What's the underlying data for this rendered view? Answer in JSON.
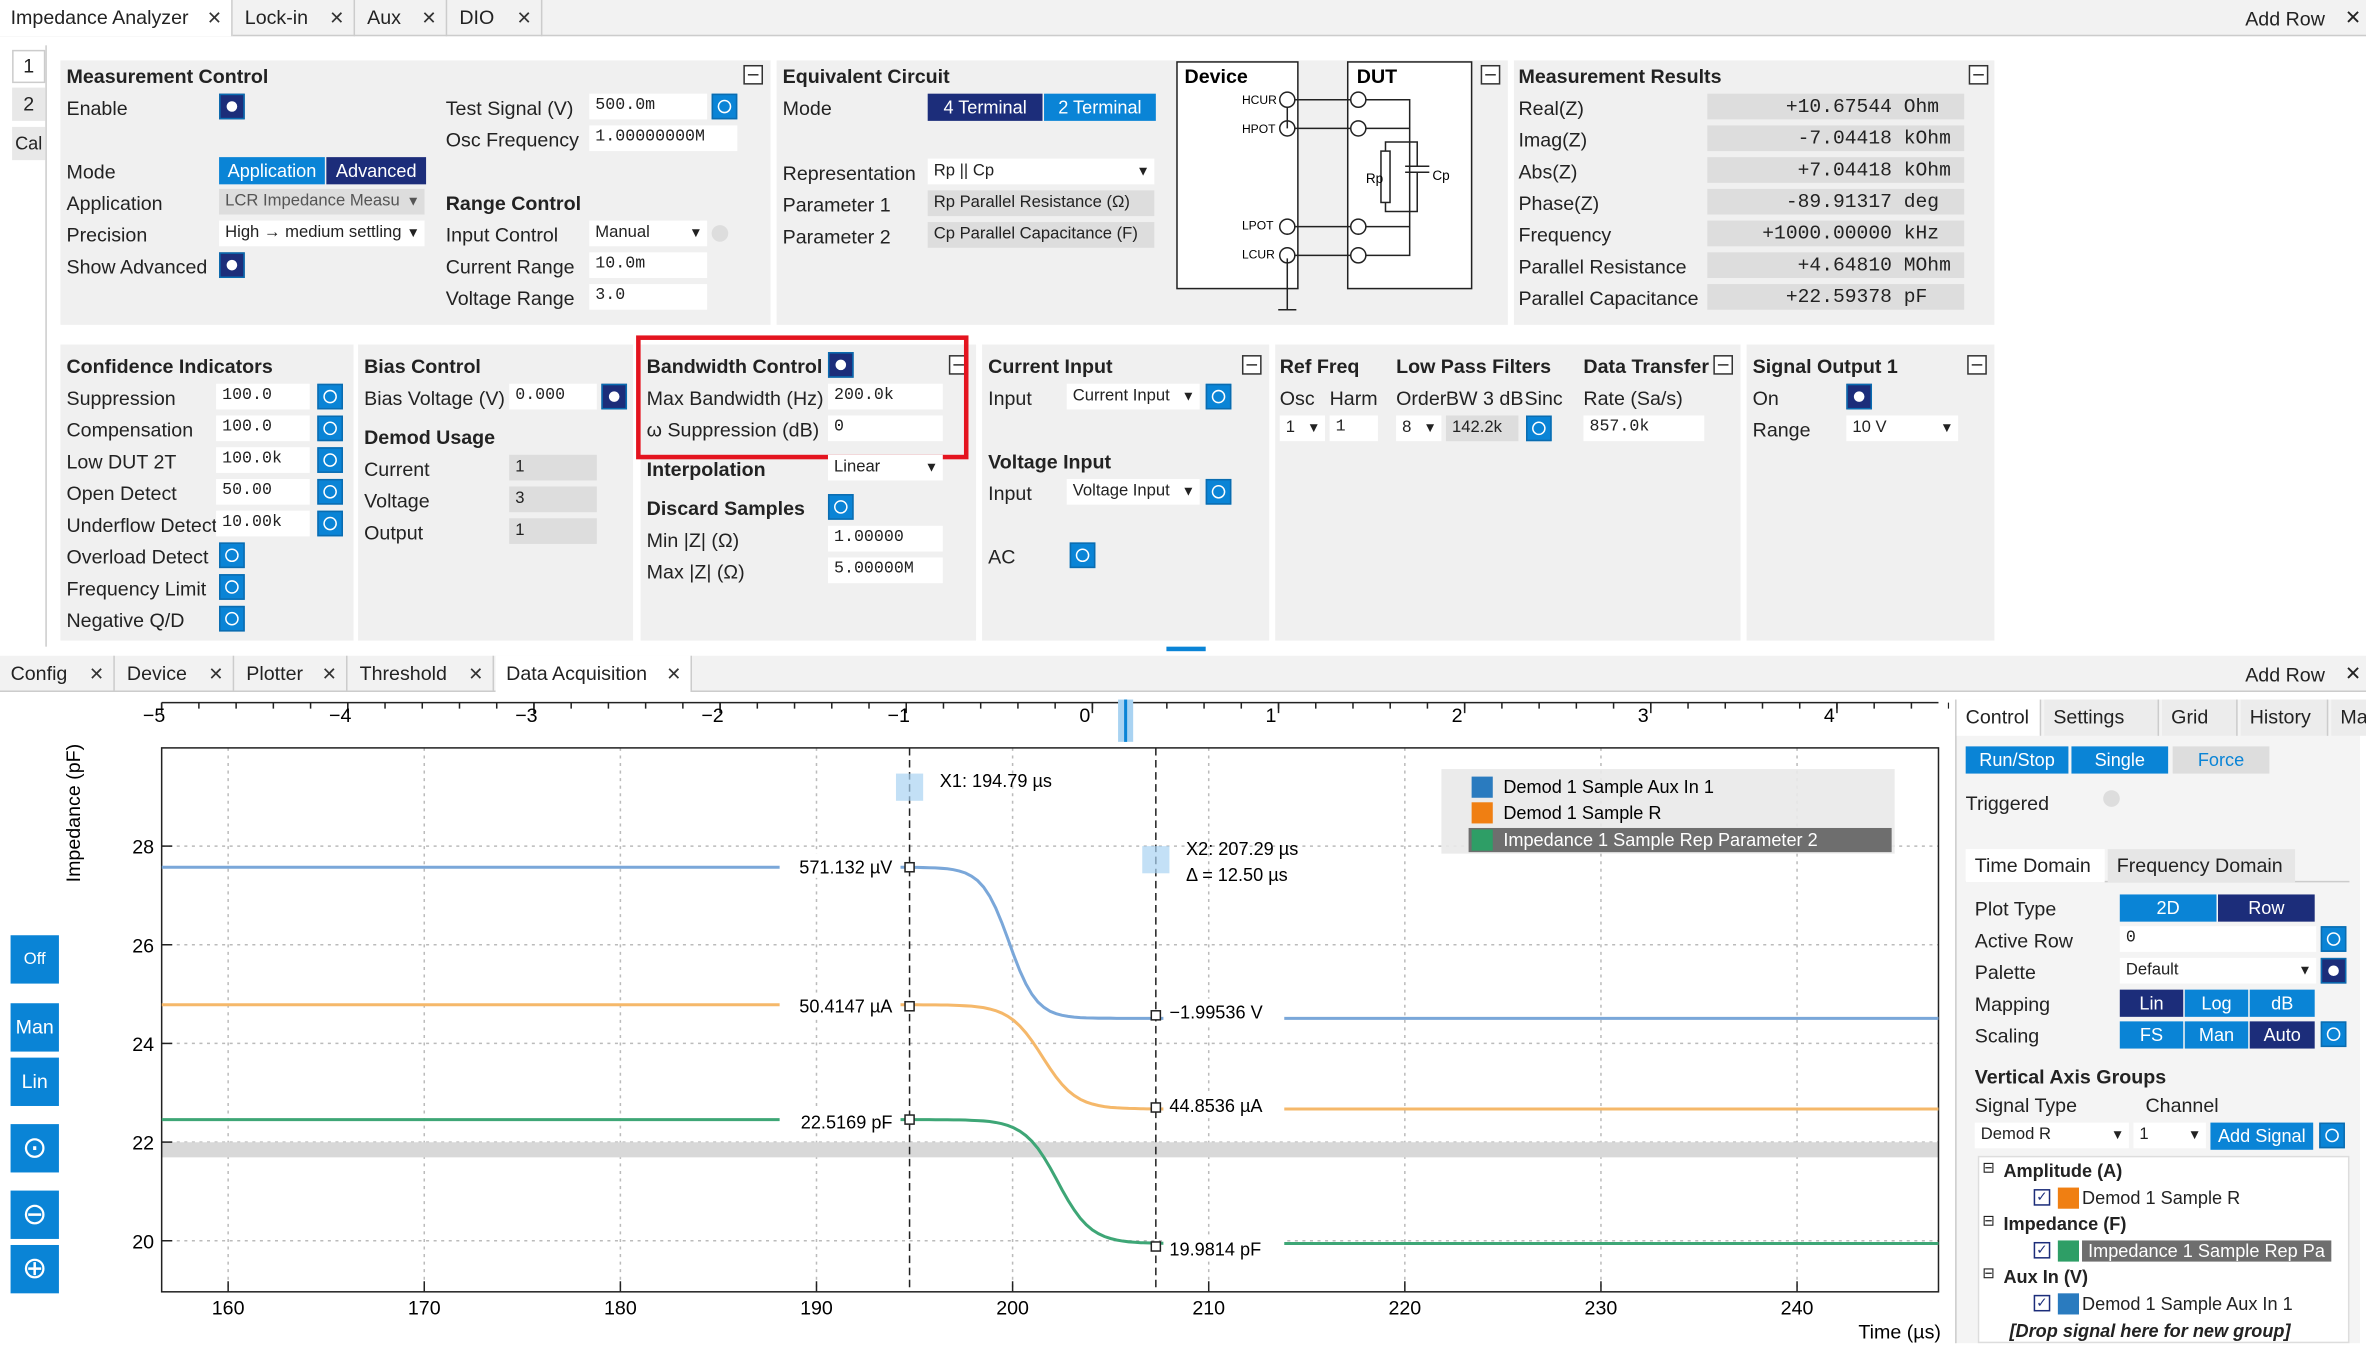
{
  "top_tabs": [
    "Impedance Analyzer",
    "Lock-in",
    "Aux",
    "DIO"
  ],
  "add_row": "Add Row",
  "side_tabs": [
    "1",
    "2",
    "Cal"
  ],
  "mc": {
    "title": "Measurement Control",
    "enable": "Enable",
    "test_signal": "Test Signal (V)",
    "test_signal_val": "500.0m",
    "osc_freq": "Osc Frequency",
    "osc_freq_val": "1.00000000M",
    "mode": "Mode",
    "mode_app": "Application",
    "mode_adv": "Advanced",
    "application": "Application",
    "application_val": "LCR Impedance Measu",
    "precision": "Precision",
    "precision_val": "High → medium settling",
    "show_adv": "Show Advanced"
  },
  "rc": {
    "title": "Range Control",
    "input_control": "Input Control",
    "input_control_val": "Manual",
    "current_range": "Current Range",
    "current_range_val": "10.0m",
    "voltage_range": "Voltage Range",
    "voltage_range_val": "3.0"
  },
  "eq": {
    "title": "Equivalent Circuit",
    "mode": "Mode",
    "t4": "4 Terminal",
    "t2": "2 Terminal",
    "rep": "Representation",
    "rep_val": "Rp || Cp",
    "p1": "Parameter 1",
    "p1_val": "Rp Parallel Resistance (Ω)",
    "p2": "Parameter 2",
    "p2_val": "Cp Parallel Capacitance (F)",
    "device": "Device",
    "dut": "DUT",
    "hcur": "HCUR",
    "hpot": "HPOT",
    "lpot": "LPOT",
    "lcur": "LCUR",
    "rp": "Rp",
    "cp": "Cp"
  },
  "mr": {
    "title": "Measurement Results",
    "rows": [
      {
        "l": "Real(Z)",
        "v": "+10.67544",
        "u": "Ohm"
      },
      {
        "l": "Imag(Z)",
        "v": "-7.04418",
        "u": "kOhm"
      },
      {
        "l": "Abs(Z)",
        "v": "+7.04418",
        "u": "kOhm"
      },
      {
        "l": "Phase(Z)",
        "v": "-89.91317",
        "u": "deg"
      },
      {
        "l": "Frequency",
        "v": "+1000.00000",
        "u": "kHz"
      },
      {
        "l": "Parallel Resistance",
        "v": "+4.64810",
        "u": "MOhm"
      },
      {
        "l": "Parallel Capacitance",
        "v": "+22.59378",
        "u": "pF"
      }
    ]
  },
  "ci": {
    "title": "Confidence Indicators",
    "rows": [
      {
        "l": "Suppression",
        "v": "100.0"
      },
      {
        "l": "Compensation",
        "v": "100.0"
      },
      {
        "l": "Low DUT 2T",
        "v": "100.0k"
      },
      {
        "l": "Open Detect",
        "v": "50.00"
      },
      {
        "l": "Underflow Detect",
        "v": "10.00k"
      },
      {
        "l": "Overload Detect"
      },
      {
        "l": "Frequency Limit"
      },
      {
        "l": "Negative Q/D"
      }
    ]
  },
  "bc": {
    "title": "Bias Control",
    "bias_v": "Bias Voltage (V)",
    "bias_v_val": "0.000"
  },
  "du": {
    "title": "Demod Usage",
    "current": "Current",
    "current_val": "1",
    "voltage": "Voltage",
    "voltage_val": "3",
    "output": "Output",
    "output_val": "1"
  },
  "bw": {
    "title": "Bandwidth Control",
    "max_bw": "Max Bandwidth (Hz)",
    "max_bw_val": "200.0k",
    "omega": "ω Suppression (dB)",
    "omega_val": "0"
  },
  "interp": {
    "title": "Interpolation",
    "val": "Linear"
  },
  "ds": {
    "title": "Discard Samples",
    "min": "Min |Z| (Ω)",
    "min_val": "1.00000",
    "max": "Max |Z| (Ω)",
    "max_val": "5.00000M"
  },
  "cur": {
    "title": "Current Input",
    "input": "Input",
    "input_val": "Current Input"
  },
  "vol": {
    "title": "Voltage Input",
    "input": "Input",
    "input_val": "Voltage Input",
    "ac": "AC"
  },
  "rf": {
    "title": "Ref Freq",
    "osc": "Osc",
    "harm": "Harm",
    "osc_val": "1",
    "harm_val": "1"
  },
  "lpf": {
    "title": "Low Pass Filters",
    "order": "Order",
    "bw": "BW 3 dB",
    "sinc": "Sinc",
    "order_val": "8",
    "bw_val": "142.2k"
  },
  "dt": {
    "title": "Data Transfer",
    "rate": "Rate (Sa/s)",
    "rate_val": "857.0k"
  },
  "so": {
    "title": "Signal Output 1",
    "on": "On",
    "range": "Range",
    "range_val": "10 V"
  },
  "bottom_tabs": [
    "Config",
    "Device",
    "Plotter",
    "Threshold",
    "Data Acquisition"
  ],
  "plot": {
    "ylabel": "Impedance (pF)",
    "xlabel": "Time (µs)",
    "top_ticks": [
      "−5",
      "−4",
      "−3",
      "−2",
      "−1",
      "0",
      "1",
      "2",
      "3",
      "4"
    ],
    "bottom_ticks": [
      "160",
      "170",
      "180",
      "190",
      "200",
      "210",
      "220",
      "230",
      "240"
    ],
    "y_ticks": [
      "28",
      "26",
      "24",
      "22",
      "20"
    ],
    "x1": "X1: 194.79 µs",
    "x2": "X2: 207.29 µs",
    "delta": "Δ = 12.50 µs",
    "ann": [
      "571.132 µV",
      "50.4147 µA",
      "22.5169 pF",
      "−1.99536 V",
      "44.8536 µA",
      "19.9814 pF"
    ],
    "legend": [
      "Demod 1 Sample Aux In 1",
      "Demod 1 Sample R",
      "Impedance 1 Sample Rep Parameter 2"
    ],
    "tools": [
      "Off",
      "Man",
      "Lin"
    ]
  },
  "rp": {
    "tabs": [
      "Control",
      "Settings",
      "Grid",
      "History",
      "Math"
    ],
    "run": "Run/Stop",
    "single": "Single",
    "force": "Force",
    "triggered": "Triggered",
    "dtabs": [
      "Time Domain",
      "Frequency Domain"
    ],
    "plot_type": "Plot Type",
    "pt2d": "2D",
    "ptrow": "Row",
    "active_row": "Active Row",
    "active_row_val": "0",
    "palette": "Palette",
    "palette_val": "Default",
    "mapping": "Mapping",
    "m1": "Lin",
    "m2": "Log",
    "m3": "dB",
    "scaling": "Scaling",
    "s1": "FS",
    "s2": "Man",
    "s3": "Auto",
    "vag": "Vertical Axis Groups",
    "sig_type": "Signal Type",
    "channel": "Channel",
    "sig_type_val": "Demod R",
    "channel_val": "1",
    "add_signal": "Add Signal",
    "groups": [
      {
        "g": "Amplitude (A)",
        "s": "Demod 1 Sample R"
      },
      {
        "g": "Impedance (F)",
        "s": "Impedance 1 Sample Rep Pa"
      },
      {
        "g": "Aux In (V)",
        "s": "Demod 1 Sample Aux In 1"
      }
    ],
    "drop": "[Drop signal here for new group]"
  },
  "colors": {
    "accent": "#0a84d6",
    "dark": "#1c2d7a",
    "s_blue": "#2a7bbf",
    "s_orange": "#f07f12",
    "s_green": "#2e9e66",
    "highlight": "#e4141f"
  }
}
